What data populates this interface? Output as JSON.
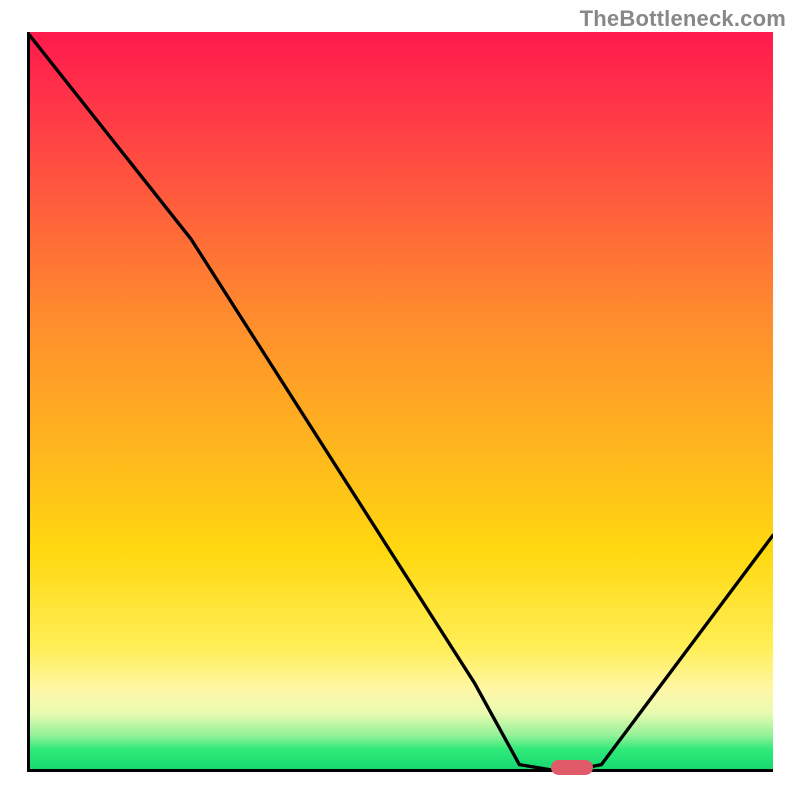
{
  "watermark": "TheBottleneck.com",
  "chart_data": {
    "type": "line",
    "title": "",
    "xlabel": "",
    "ylabel": "",
    "xlim": [
      0,
      100
    ],
    "ylim": [
      0,
      100
    ],
    "grid": false,
    "series": [
      {
        "name": "bottleneck-curve",
        "x": [
          0,
          22,
          60,
          66,
          72,
          77,
          100
        ],
        "values": [
          100,
          72,
          12,
          1,
          0,
          1,
          32
        ]
      }
    ],
    "annotations": [
      {
        "name": "optimal-marker",
        "x": 73,
        "y": 0,
        "shape": "pill",
        "color": "#e05a6a"
      }
    ],
    "gradient_stops": [
      {
        "pct": 0,
        "color": "#ff1a4d"
      },
      {
        "pct": 8,
        "color": "#ff3049"
      },
      {
        "pct": 22,
        "color": "#ff5a3d"
      },
      {
        "pct": 38,
        "color": "#ff8b2e"
      },
      {
        "pct": 55,
        "color": "#ffb31f"
      },
      {
        "pct": 70,
        "color": "#ffd80f"
      },
      {
        "pct": 83,
        "color": "#ffee55"
      },
      {
        "pct": 89,
        "color": "#fff7a8"
      },
      {
        "pct": 92,
        "color": "#e9fbb0"
      },
      {
        "pct": 95,
        "color": "#95f29a"
      },
      {
        "pct": 97,
        "color": "#2fe978"
      },
      {
        "pct": 100,
        "color": "#12d86f"
      }
    ]
  }
}
